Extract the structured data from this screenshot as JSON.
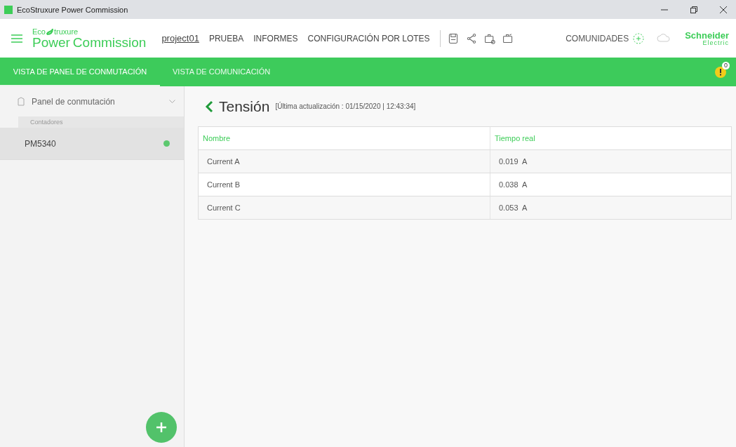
{
  "window": {
    "title": "EcoStruxure Power Commission"
  },
  "header": {
    "logo": {
      "eco": "Eco",
      "truxure": "truxure",
      "power": "Power",
      "commission": "Commission"
    },
    "menu": [
      {
        "label": "project01",
        "kind": "link"
      },
      {
        "label": "PRUEBA",
        "kind": "plain"
      },
      {
        "label": "INFORMES",
        "kind": "plain"
      },
      {
        "label": "CONFIGURACIÓN POR LOTES",
        "kind": "plain"
      }
    ],
    "communities": "COMUNIDADES",
    "brand": {
      "name": "Schneider",
      "sub": "Electric"
    }
  },
  "tabs": [
    {
      "label": "VISTA DE PANEL DE CONMUTACIÓN",
      "selected": true
    },
    {
      "label": "VISTA DE COMUNICACIÓN",
      "selected": false
    }
  ],
  "alerts": {
    "count": "0"
  },
  "sidebar": {
    "title": "Panel de conmutación",
    "section": "Contadores",
    "items": [
      {
        "label": "PM5340",
        "selected": true,
        "color": "#5cc86e"
      }
    ]
  },
  "content": {
    "title": "Tensión",
    "updated": "[Última actualización : 01/15/2020 | 12:43:34]",
    "table": {
      "columns": [
        "Nombre",
        "Tiempo real"
      ],
      "rows": [
        [
          "Current A",
          "0.019  A"
        ],
        [
          "Current B",
          "0.038  A"
        ],
        [
          "Current C",
          "0.053  A"
        ]
      ]
    }
  }
}
